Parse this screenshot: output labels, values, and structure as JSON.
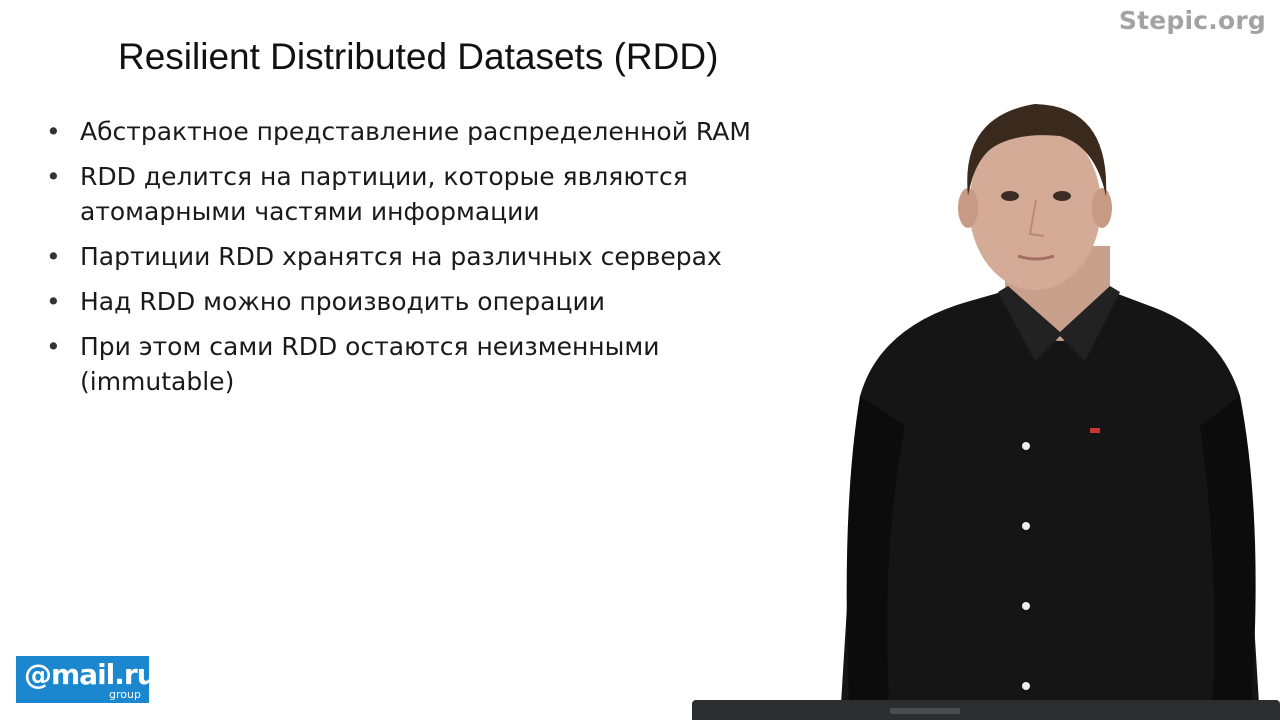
{
  "watermark": "Stepic.org",
  "slide": {
    "title": "Resilient Distributed Datasets (RDD)",
    "bullets": [
      {
        "marker": "•",
        "text": "Абстрактное представление распределенной RAM"
      },
      {
        "marker": "•",
        "text": "RDD делится на партиции, которые являются атомарными частями информации"
      },
      {
        "marker": "•",
        "text": "Партиции RDD хранятся на различных серверах"
      },
      {
        "marker": "•",
        "text": "Над RDD можно производить операции"
      },
      {
        "marker": "•",
        "text": "При этом сами RDD остаются неизменными (immutable)"
      }
    ]
  },
  "logo": {
    "main": "@mail.ru",
    "sub": "group",
    "color": "#1b87cf"
  },
  "colors": {
    "background": "#ffffff",
    "text": "#1a1a1a",
    "watermark": "#a3a3a3"
  }
}
